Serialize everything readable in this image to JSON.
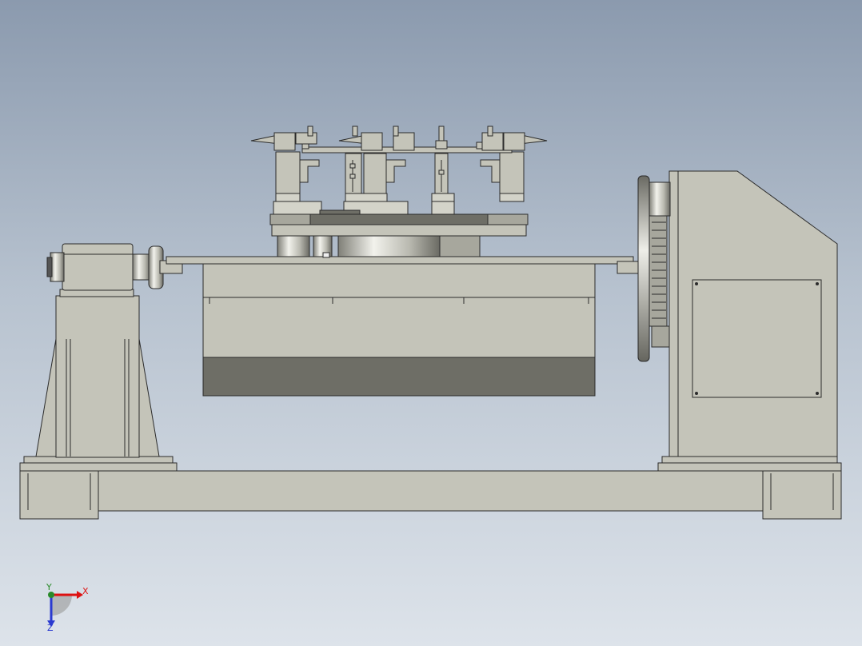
{
  "triad": {
    "x_label": "X",
    "y_label": "Y",
    "z_label": "Z",
    "x_color": "#d11",
    "y_color": "#2a8a2a",
    "z_color": "#2a3ad0"
  },
  "colors": {
    "background_top": "#8b9aae",
    "background_bottom": "#dde3ea",
    "part_fill": "#c4c4b9",
    "part_dark": "#6e6e66",
    "edge": "#2b2b2b"
  }
}
